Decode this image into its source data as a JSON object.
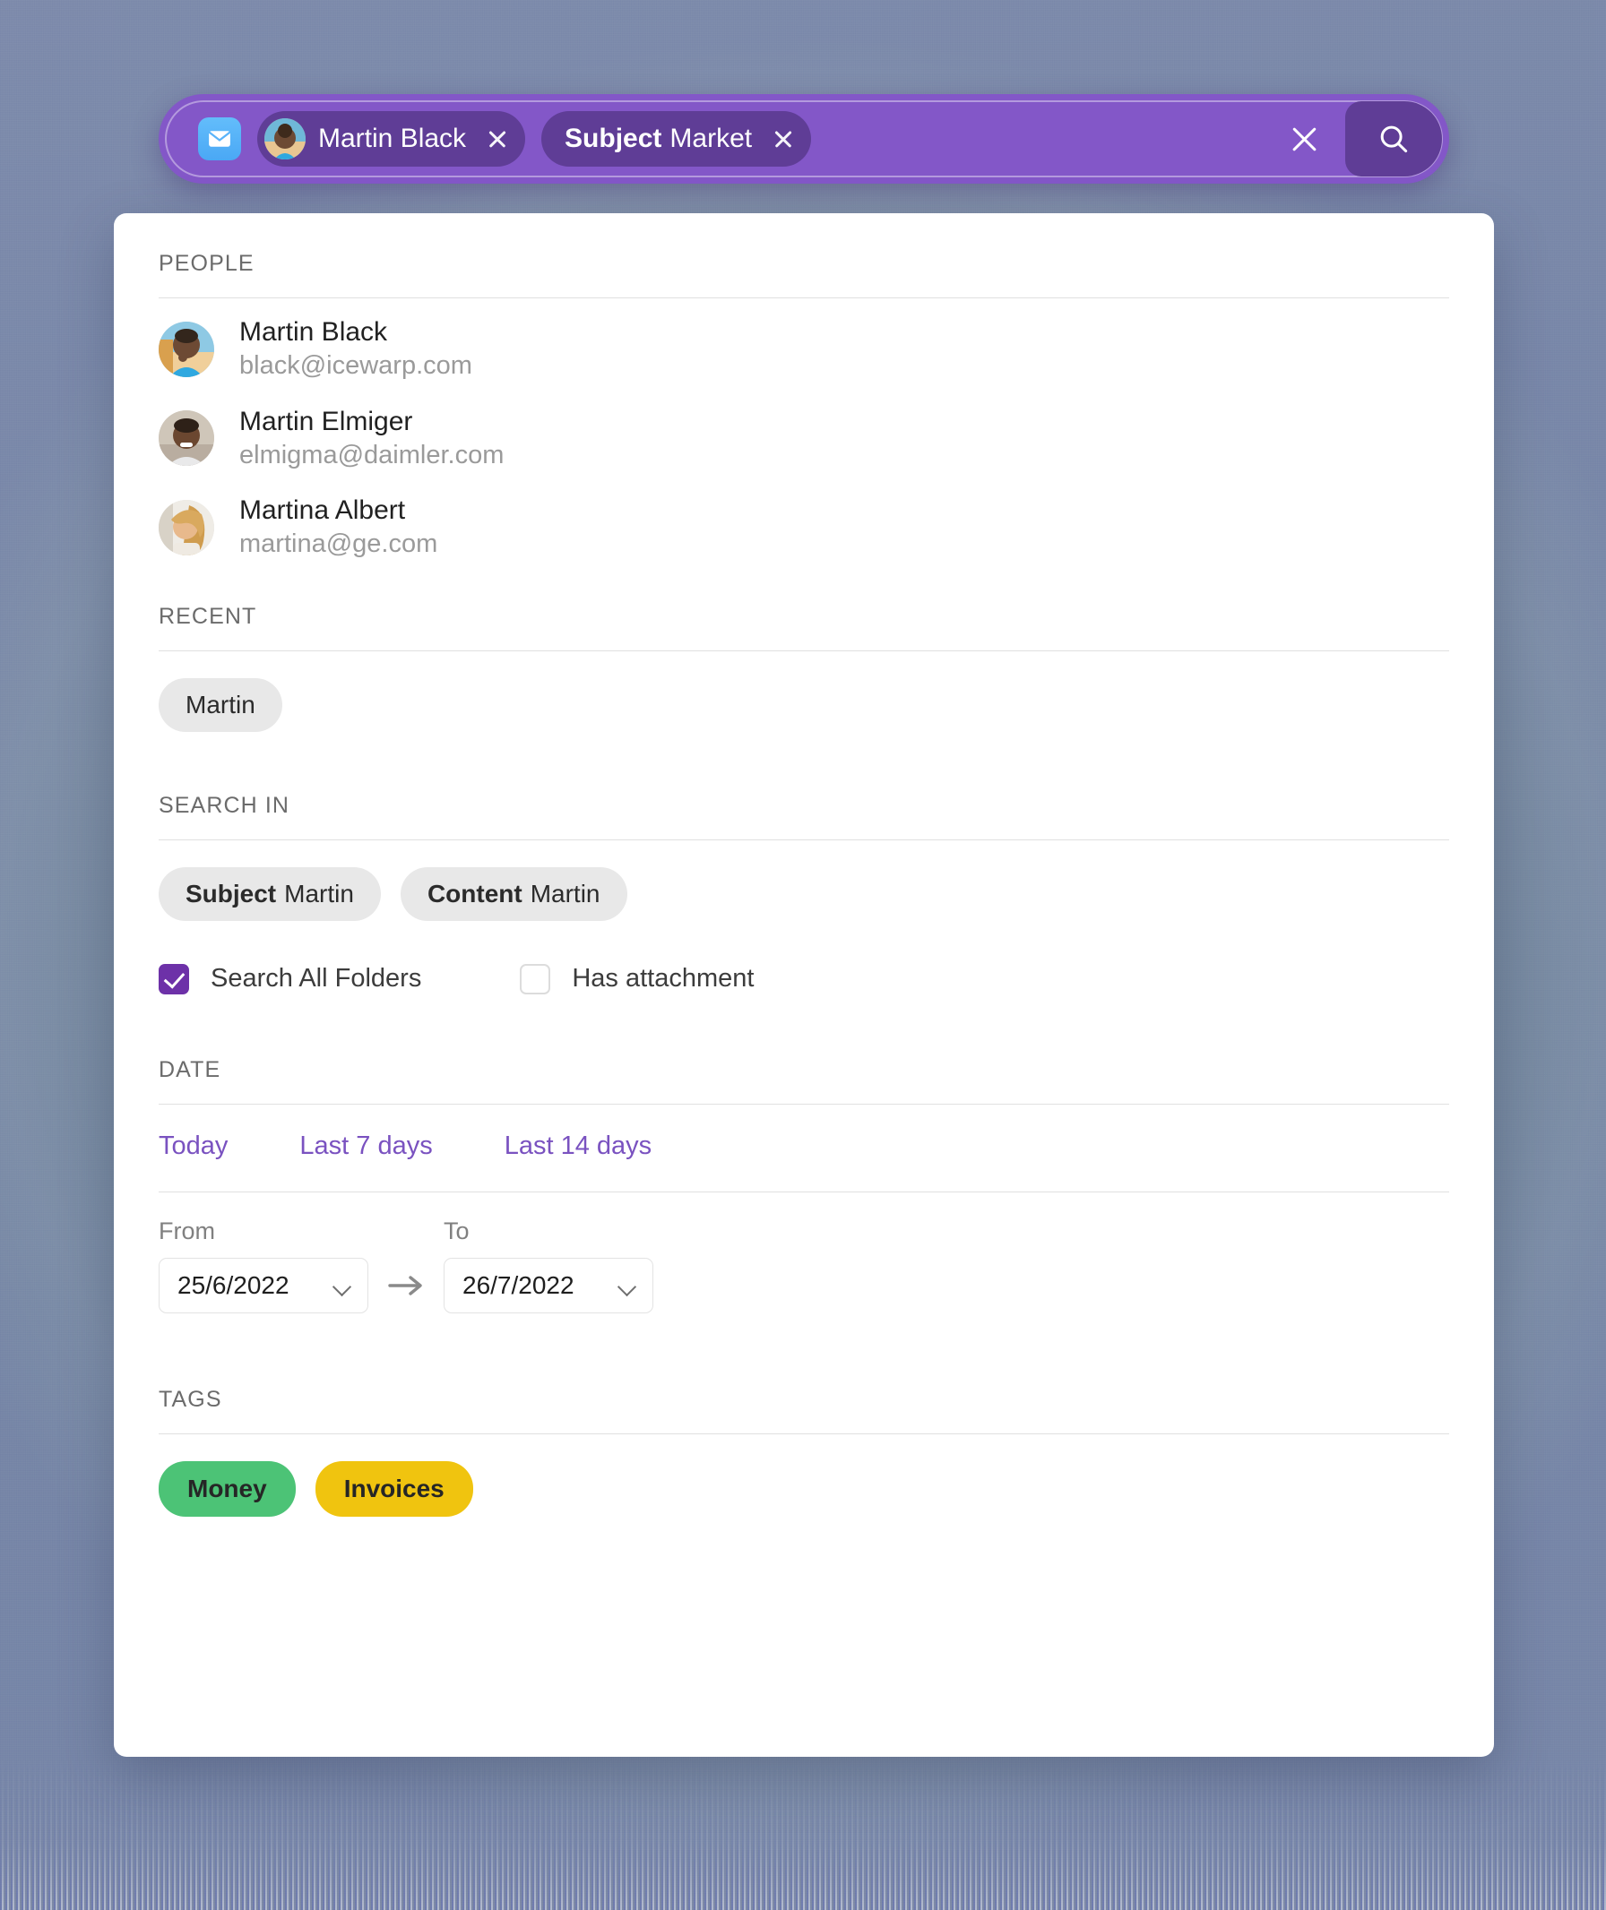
{
  "search_bar": {
    "mail_icon": "mail-icon",
    "clear_icon": "close-icon",
    "search_icon": "search-icon",
    "tokens": [
      {
        "type": "person",
        "label": "Martin Black",
        "prefix": "",
        "has_avatar": true
      },
      {
        "type": "subject",
        "prefix": "Subject",
        "label": "Market",
        "has_avatar": false
      }
    ]
  },
  "panel": {
    "people": {
      "title": "PEOPLE",
      "items": [
        {
          "name": "Martin Black",
          "email": "black@icewarp.com"
        },
        {
          "name": "Martin Elmiger",
          "email": "elmigma@daimler.com"
        },
        {
          "name": "Martina Albert",
          "email": "martina@ge.com"
        }
      ]
    },
    "recent": {
      "title": "RECENT",
      "chips": [
        {
          "prefix": "",
          "label": "Martin"
        }
      ]
    },
    "search_in": {
      "title": "SEARCH IN",
      "chips": [
        {
          "prefix": "Subject",
          "label": "Martin"
        },
        {
          "prefix": "Content",
          "label": "Martin"
        }
      ],
      "checkboxes": [
        {
          "label": "Search All Folders",
          "checked": true
        },
        {
          "label": "Has attachment",
          "checked": false
        }
      ]
    },
    "date": {
      "title": "DATE",
      "quick_links": [
        "Today",
        "Last 7 days",
        "Last 14 days"
      ],
      "from_label": "From",
      "to_label": "To",
      "from_value": "25/6/2022",
      "to_value": "26/7/2022"
    },
    "tags": {
      "title": "TAGS",
      "items": [
        {
          "label": "Money",
          "color": "#4CC376"
        },
        {
          "label": "Invoices",
          "color": "#F0C40F"
        }
      ]
    }
  },
  "colors": {
    "bar_purple": "#8357c8",
    "token_purple": "#5f3d96",
    "accent_purple": "#7a52c0",
    "checkbox_purple": "#6D31A8",
    "tag_green": "#4CC376",
    "tag_yellow": "#F0C40F",
    "background": "#75889a"
  }
}
